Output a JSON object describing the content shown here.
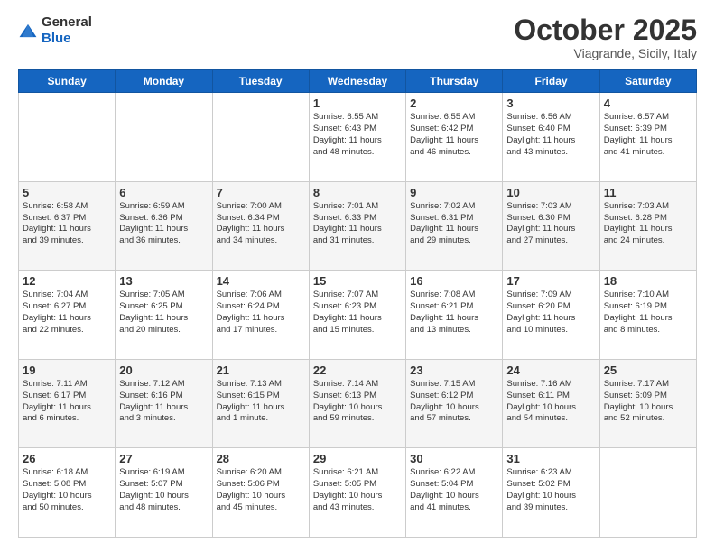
{
  "header": {
    "logo_general": "General",
    "logo_blue": "Blue",
    "month": "October 2025",
    "location": "Viagrande, Sicily, Italy"
  },
  "days_of_week": [
    "Sunday",
    "Monday",
    "Tuesday",
    "Wednesday",
    "Thursday",
    "Friday",
    "Saturday"
  ],
  "weeks": [
    {
      "alt": false,
      "days": [
        {
          "date": "",
          "info": ""
        },
        {
          "date": "",
          "info": ""
        },
        {
          "date": "",
          "info": ""
        },
        {
          "date": "1",
          "info": "Sunrise: 6:55 AM\nSunset: 6:43 PM\nDaylight: 11 hours\nand 48 minutes."
        },
        {
          "date": "2",
          "info": "Sunrise: 6:55 AM\nSunset: 6:42 PM\nDaylight: 11 hours\nand 46 minutes."
        },
        {
          "date": "3",
          "info": "Sunrise: 6:56 AM\nSunset: 6:40 PM\nDaylight: 11 hours\nand 43 minutes."
        },
        {
          "date": "4",
          "info": "Sunrise: 6:57 AM\nSunset: 6:39 PM\nDaylight: 11 hours\nand 41 minutes."
        }
      ]
    },
    {
      "alt": true,
      "days": [
        {
          "date": "5",
          "info": "Sunrise: 6:58 AM\nSunset: 6:37 PM\nDaylight: 11 hours\nand 39 minutes."
        },
        {
          "date": "6",
          "info": "Sunrise: 6:59 AM\nSunset: 6:36 PM\nDaylight: 11 hours\nand 36 minutes."
        },
        {
          "date": "7",
          "info": "Sunrise: 7:00 AM\nSunset: 6:34 PM\nDaylight: 11 hours\nand 34 minutes."
        },
        {
          "date": "8",
          "info": "Sunrise: 7:01 AM\nSunset: 6:33 PM\nDaylight: 11 hours\nand 31 minutes."
        },
        {
          "date": "9",
          "info": "Sunrise: 7:02 AM\nSunset: 6:31 PM\nDaylight: 11 hours\nand 29 minutes."
        },
        {
          "date": "10",
          "info": "Sunrise: 7:03 AM\nSunset: 6:30 PM\nDaylight: 11 hours\nand 27 minutes."
        },
        {
          "date": "11",
          "info": "Sunrise: 7:03 AM\nSunset: 6:28 PM\nDaylight: 11 hours\nand 24 minutes."
        }
      ]
    },
    {
      "alt": false,
      "days": [
        {
          "date": "12",
          "info": "Sunrise: 7:04 AM\nSunset: 6:27 PM\nDaylight: 11 hours\nand 22 minutes."
        },
        {
          "date": "13",
          "info": "Sunrise: 7:05 AM\nSunset: 6:25 PM\nDaylight: 11 hours\nand 20 minutes."
        },
        {
          "date": "14",
          "info": "Sunrise: 7:06 AM\nSunset: 6:24 PM\nDaylight: 11 hours\nand 17 minutes."
        },
        {
          "date": "15",
          "info": "Sunrise: 7:07 AM\nSunset: 6:23 PM\nDaylight: 11 hours\nand 15 minutes."
        },
        {
          "date": "16",
          "info": "Sunrise: 7:08 AM\nSunset: 6:21 PM\nDaylight: 11 hours\nand 13 minutes."
        },
        {
          "date": "17",
          "info": "Sunrise: 7:09 AM\nSunset: 6:20 PM\nDaylight: 11 hours\nand 10 minutes."
        },
        {
          "date": "18",
          "info": "Sunrise: 7:10 AM\nSunset: 6:19 PM\nDaylight: 11 hours\nand 8 minutes."
        }
      ]
    },
    {
      "alt": true,
      "days": [
        {
          "date": "19",
          "info": "Sunrise: 7:11 AM\nSunset: 6:17 PM\nDaylight: 11 hours\nand 6 minutes."
        },
        {
          "date": "20",
          "info": "Sunrise: 7:12 AM\nSunset: 6:16 PM\nDaylight: 11 hours\nand 3 minutes."
        },
        {
          "date": "21",
          "info": "Sunrise: 7:13 AM\nSunset: 6:15 PM\nDaylight: 11 hours\nand 1 minute."
        },
        {
          "date": "22",
          "info": "Sunrise: 7:14 AM\nSunset: 6:13 PM\nDaylight: 10 hours\nand 59 minutes."
        },
        {
          "date": "23",
          "info": "Sunrise: 7:15 AM\nSunset: 6:12 PM\nDaylight: 10 hours\nand 57 minutes."
        },
        {
          "date": "24",
          "info": "Sunrise: 7:16 AM\nSunset: 6:11 PM\nDaylight: 10 hours\nand 54 minutes."
        },
        {
          "date": "25",
          "info": "Sunrise: 7:17 AM\nSunset: 6:09 PM\nDaylight: 10 hours\nand 52 minutes."
        }
      ]
    },
    {
      "alt": false,
      "days": [
        {
          "date": "26",
          "info": "Sunrise: 6:18 AM\nSunset: 5:08 PM\nDaylight: 10 hours\nand 50 minutes."
        },
        {
          "date": "27",
          "info": "Sunrise: 6:19 AM\nSunset: 5:07 PM\nDaylight: 10 hours\nand 48 minutes."
        },
        {
          "date": "28",
          "info": "Sunrise: 6:20 AM\nSunset: 5:06 PM\nDaylight: 10 hours\nand 45 minutes."
        },
        {
          "date": "29",
          "info": "Sunrise: 6:21 AM\nSunset: 5:05 PM\nDaylight: 10 hours\nand 43 minutes."
        },
        {
          "date": "30",
          "info": "Sunrise: 6:22 AM\nSunset: 5:04 PM\nDaylight: 10 hours\nand 41 minutes."
        },
        {
          "date": "31",
          "info": "Sunrise: 6:23 AM\nSunset: 5:02 PM\nDaylight: 10 hours\nand 39 minutes."
        },
        {
          "date": "",
          "info": ""
        }
      ]
    }
  ]
}
